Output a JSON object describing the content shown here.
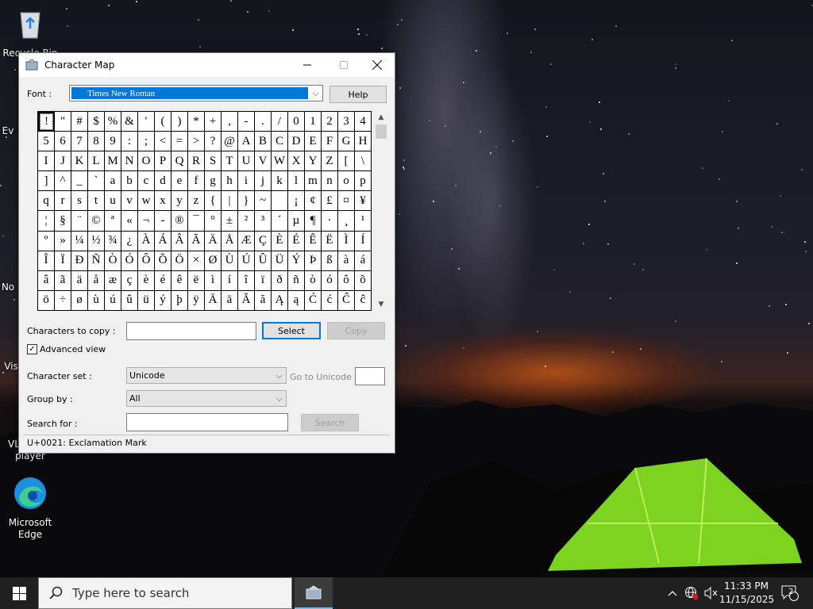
{
  "desktop": {
    "icons": [
      {
        "label": "Recycle Bin"
      },
      {
        "label": "Ev"
      },
      {
        "label": "No"
      },
      {
        "label": "Vis"
      },
      {
        "label": "VLC media player",
        "label_line1": "VL",
        "label_line2": "player"
      },
      {
        "label": "Microsoft Edge",
        "label_line1": "Microsoft",
        "label_line2": "Edge"
      }
    ]
  },
  "window": {
    "title": "Character Map",
    "font_label": "Font :",
    "font_value": "Times New Roman",
    "help_label": "Help",
    "chars_to_copy_label": "Characters to copy :",
    "chars_to_copy_value": "",
    "select_label": "Select",
    "copy_label": "Copy",
    "advanced_view_label": "Advanced view",
    "advanced_view_checked": true,
    "character_set_label": "Character set :",
    "character_set_value": "Unicode",
    "go_to_unicode_label": "Go to Unicode :",
    "go_to_unicode_value": "",
    "group_by_label": "Group by :",
    "group_by_value": "All",
    "search_for_label": "Search for :",
    "search_for_value": "",
    "search_label": "Search",
    "status": "U+0021: Exclamation Mark",
    "grid_chars": [
      "!",
      "\"",
      "#",
      "$",
      "%",
      "&",
      "'",
      "(",
      ")",
      "*",
      "+",
      ",",
      "-",
      ".",
      "/",
      "0",
      "1",
      "2",
      "3",
      "4",
      "5",
      "6",
      "7",
      "8",
      "9",
      ":",
      ";",
      "<",
      "=",
      ">",
      "?",
      "@",
      "A",
      "B",
      "C",
      "D",
      "E",
      "F",
      "G",
      "H",
      "I",
      "J",
      "K",
      "L",
      "M",
      "N",
      "O",
      "P",
      "Q",
      "R",
      "S",
      "T",
      "U",
      "V",
      "W",
      "X",
      "Y",
      "Z",
      "[",
      "\\",
      "]",
      "^",
      "_",
      "`",
      "a",
      "b",
      "c",
      "d",
      "e",
      "f",
      "g",
      "h",
      "i",
      "j",
      "k",
      "l",
      "m",
      "n",
      "o",
      "p",
      "q",
      "r",
      "s",
      "t",
      "u",
      "v",
      "w",
      "x",
      "y",
      "z",
      "{",
      "|",
      "}",
      "~",
      " ",
      "¡",
      "¢",
      "£",
      "¤",
      "¥",
      "¦",
      "§",
      "¨",
      "©",
      "ª",
      "«",
      "¬",
      "-",
      "®",
      "¯",
      "°",
      "±",
      "²",
      "³",
      "´",
      "µ",
      "¶",
      "·",
      "¸",
      "¹",
      "º",
      "»",
      "¼",
      "½",
      "¾",
      "¿",
      "À",
      "Á",
      "Â",
      "Ã",
      "Ä",
      "Å",
      "Æ",
      "Ç",
      "È",
      "É",
      "Ê",
      "Ë",
      "Ì",
      "Í",
      "Î",
      "Ï",
      "Ð",
      "Ñ",
      "Ò",
      "Ó",
      "Ô",
      "Õ",
      "Ö",
      "×",
      "Ø",
      "Ù",
      "Ú",
      "Û",
      "Ü",
      "Ý",
      "Þ",
      "ß",
      "à",
      "á",
      "â",
      "ã",
      "ä",
      "å",
      "æ",
      "ç",
      "è",
      "é",
      "ê",
      "ë",
      "ì",
      "í",
      "î",
      "ï",
      "ð",
      "ñ",
      "ò",
      "ó",
      "ô",
      "õ",
      "ö",
      "÷",
      "ø",
      "ù",
      "ú",
      "û",
      "ü",
      "ý",
      "þ",
      "ÿ",
      "Ā",
      "ā",
      "Ă",
      "ă",
      "Ą",
      "ą",
      "Ć",
      "ć",
      "Ĉ",
      "ĉ"
    ],
    "selected_index": 0
  },
  "taskbar": {
    "search_placeholder": "Type here to search",
    "time": "11:33 PM",
    "date": "11/15/2025",
    "notification_count": "2"
  },
  "colors": {
    "accent": "#0078d7",
    "taskbar": "#202020",
    "window_bg": "#f0f0f0"
  }
}
